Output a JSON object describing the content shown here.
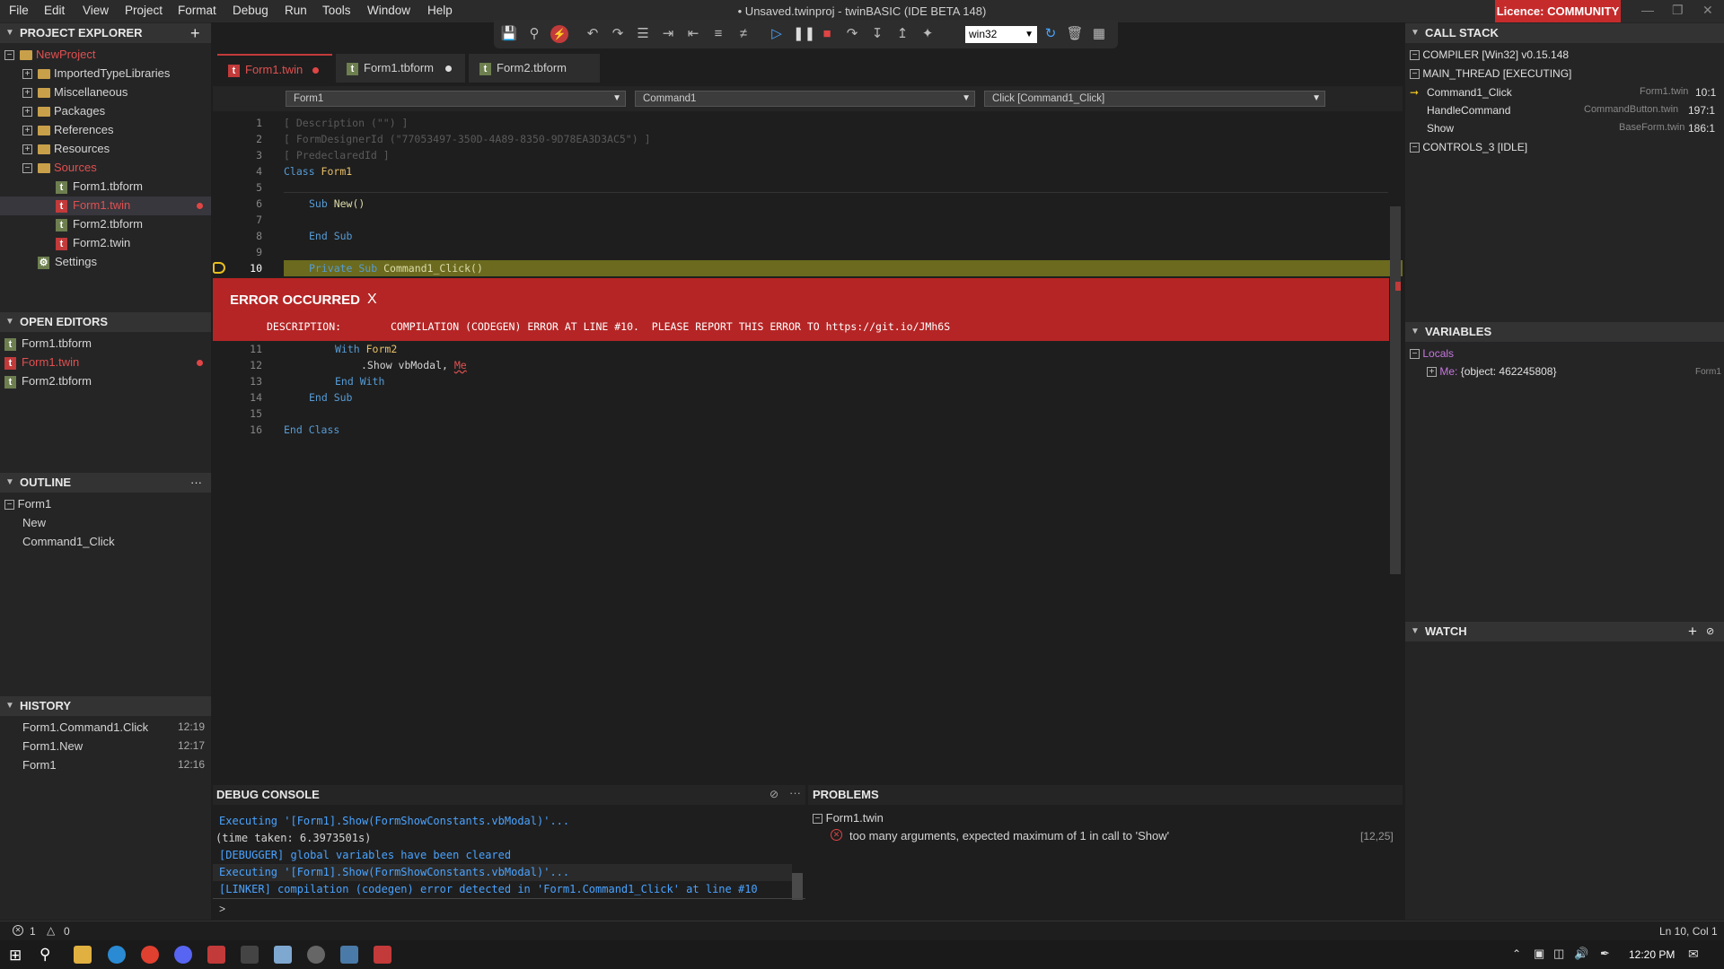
{
  "menu": [
    "File",
    "Edit",
    "View",
    "Project",
    "Format",
    "Debug",
    "Run",
    "Tools",
    "Window",
    "Help"
  ],
  "window_title": "• Unsaved.twinproj - twinBASIC (IDE BETA 148)",
  "licence": "Licence: COMMUNITY",
  "toolbar": {
    "platform": "win32"
  },
  "project_explorer": {
    "title": "PROJECT EXPLORER",
    "root": "NewProject",
    "folders": [
      "ImportedTypeLibraries",
      "Miscellaneous",
      "Packages",
      "References",
      "Resources",
      "Sources"
    ],
    "sources": [
      "Form1.tbform",
      "Form1.twin",
      "Form2.tbform",
      "Form2.twin"
    ],
    "settings": "Settings"
  },
  "open_editors": {
    "title": "OPEN EDITORS",
    "items": [
      "Form1.tbform",
      "Form1.twin",
      "Form2.tbform"
    ]
  },
  "outline": {
    "title": "OUTLINE",
    "root": "Form1",
    "items": [
      "New",
      "Command1_Click"
    ]
  },
  "history": {
    "title": "HISTORY",
    "items": [
      {
        "name": "Form1.Command1.Click",
        "time": "12:19"
      },
      {
        "name": "Form1.New",
        "time": "12:17"
      },
      {
        "name": "Form1",
        "time": "12:16"
      }
    ]
  },
  "tabs": [
    "Form1.twin",
    "Form1.tbform",
    "Form2.tbform"
  ],
  "combos": [
    "Form1",
    "Command1",
    "Click [Command1_Click]"
  ],
  "code": {
    "line_numbers": [
      "1",
      "2",
      "3",
      "4",
      "5",
      "6",
      "7",
      "8",
      "9",
      "10",
      "11",
      "12",
      "13",
      "14",
      "15",
      "16"
    ],
    "l1": "[ Description (\"\") ]",
    "l2": "[ FormDesignerId (\"77053497-350D-4A89-8350-9D78EA3D3AC5\") ]",
    "l3": "[ PredeclaredId ]",
    "l4a": "Class ",
    "l4b": "Form1",
    "l6a": "Sub ",
    "l6b": "New()",
    "l8": "End Sub",
    "l10a": "Private Sub ",
    "l10b": "Command1_Click()",
    "l11a": "With ",
    "l11b": "Form2",
    "l12a": ".Show vbModal, ",
    "l12b": "Me",
    "l13": "End With",
    "l14": "End Sub",
    "l16": "End Class"
  },
  "error": {
    "title": "ERROR OCCURRED",
    "close": "X",
    "desc_label": "DESCRIPTION:",
    "desc_text": "COMPILATION (CODEGEN) ERROR AT LINE #10.  PLEASE REPORT THIS ERROR TO https://git.io/JMh6S"
  },
  "call_stack": {
    "title": "CALL STACK",
    "compiler": "COMPILER [Win32] v0.15.148",
    "main_thread": "MAIN_THREAD [EXECUTING]",
    "frames": [
      {
        "name": "Command1_Click",
        "file": "Form1.twin",
        "pos": "10:1"
      },
      {
        "name": "HandleCommand",
        "file": "CommandButton.twin",
        "pos": "197:1"
      },
      {
        "name": "Show",
        "file": "BaseForm.twin",
        "pos": "186:1"
      }
    ],
    "controls": "CONTROLS_3 [IDLE]"
  },
  "variables": {
    "title": "VARIABLES",
    "locals": "Locals",
    "me_name": "Me:",
    "me_value": "{object: 462245808}",
    "me_type": "Form1"
  },
  "watch": {
    "title": "WATCH"
  },
  "debug_console": {
    "title": "DEBUG CONSOLE",
    "lines": [
      "Executing '[Form1].Show(FormShowConstants.vbModal)'...",
      "(time taken: 6.3973501s)",
      "[DEBUGGER] global variables have been cleared",
      "Executing '[Form1].Show(FormShowConstants.vbModal)'...",
      "[LINKER] compilation (codegen) error detected in 'Form1.Command1_Click' at line #10"
    ],
    "prompt": ">"
  },
  "problems": {
    "title": "PROBLEMS",
    "file": "Form1.twin",
    "message": "too many arguments, expected maximum of 1 in call to 'Show'",
    "pos": "[12,25]"
  },
  "status": {
    "errors": "1",
    "warnings": "0",
    "cursor": "Ln 10, Col 1"
  },
  "taskbar": {
    "time": "12:20 PM"
  },
  "colors": {
    "accent": "#c23a3a",
    "error_bar": "#b52525",
    "keyword": "#569cd6",
    "func": "#dcdcaa"
  }
}
